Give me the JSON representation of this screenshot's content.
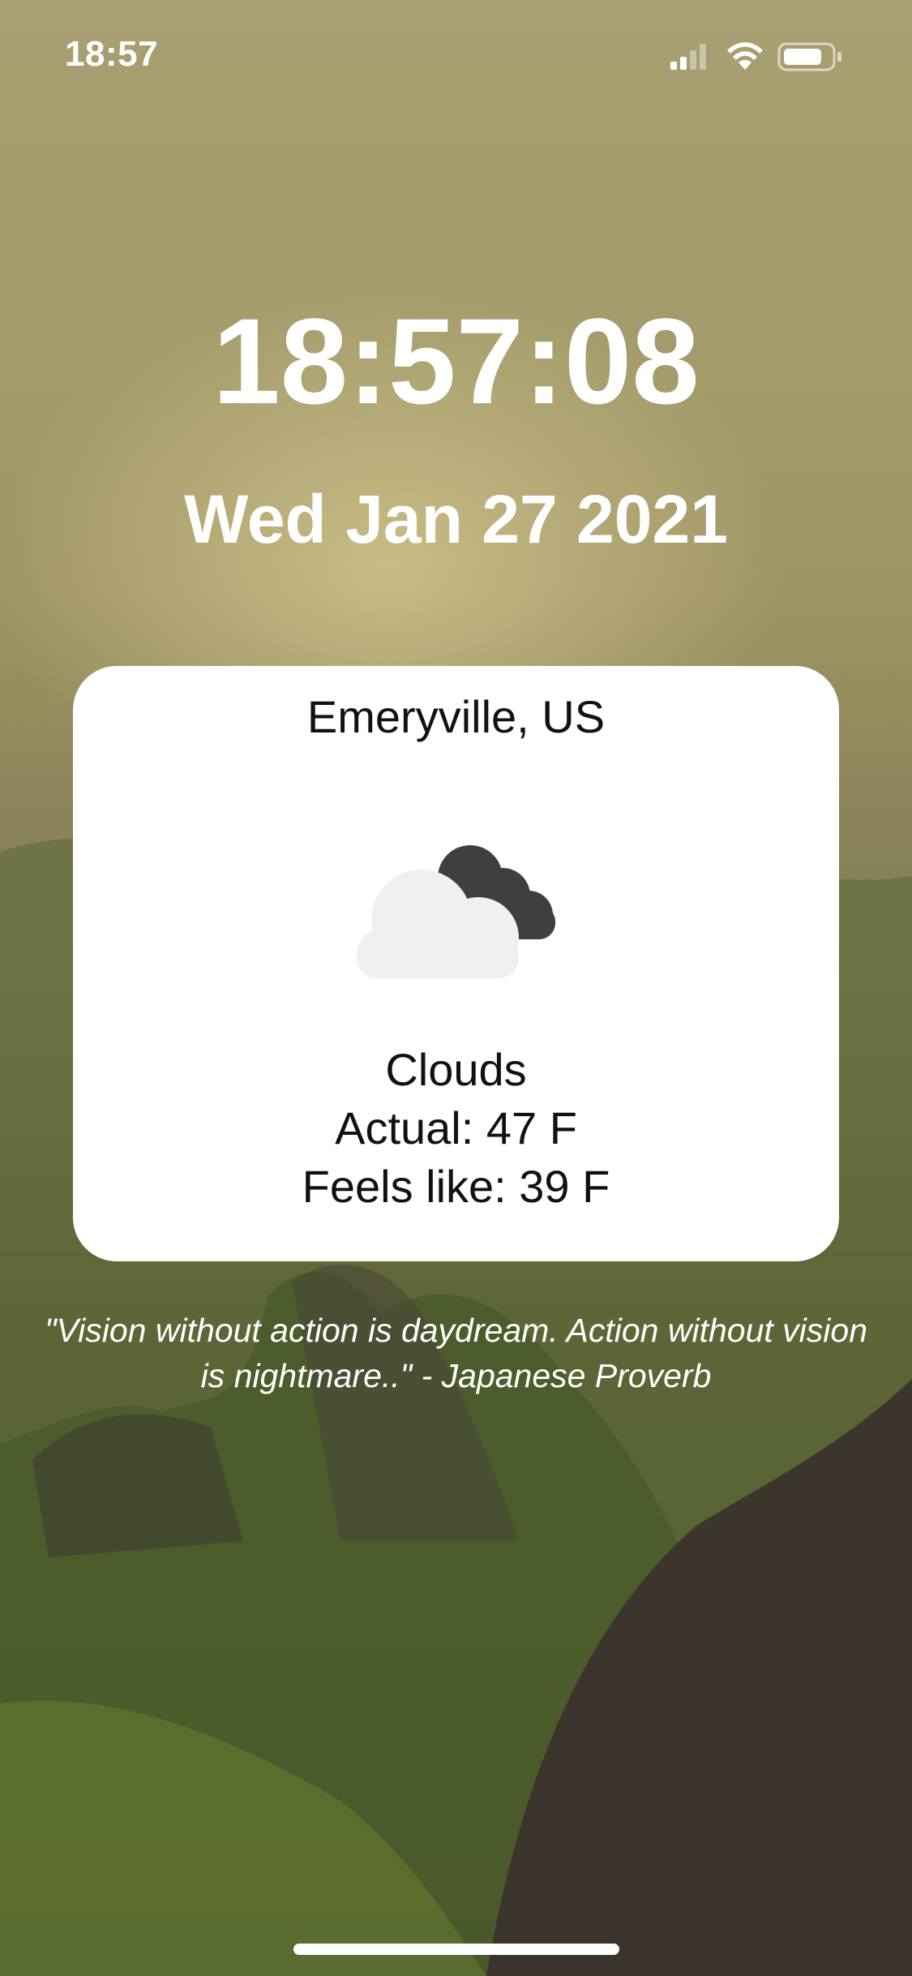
{
  "status_bar": {
    "time": "18:57",
    "signal_icon": "signal-bars-icon",
    "wifi_icon": "wifi-icon",
    "battery_icon": "battery-icon"
  },
  "clock": {
    "time": "18:57:08",
    "date": "Wed Jan 27 2021"
  },
  "weather": {
    "location": "Emeryville, US",
    "icon": "clouds-icon",
    "condition": "Clouds",
    "actual": "Actual: 47 F",
    "feels_like": "Feels like: 39 F"
  },
  "quote": {
    "text": "\"Vision without action is daydream. Action without vision is nightmare..\" - Japanese Proverb"
  },
  "colors": {
    "card_background": "#ffffff",
    "light_cloud": "#f0f0f0",
    "dark_cloud": "#3f3f42",
    "text_on_background": "#ffffff"
  }
}
